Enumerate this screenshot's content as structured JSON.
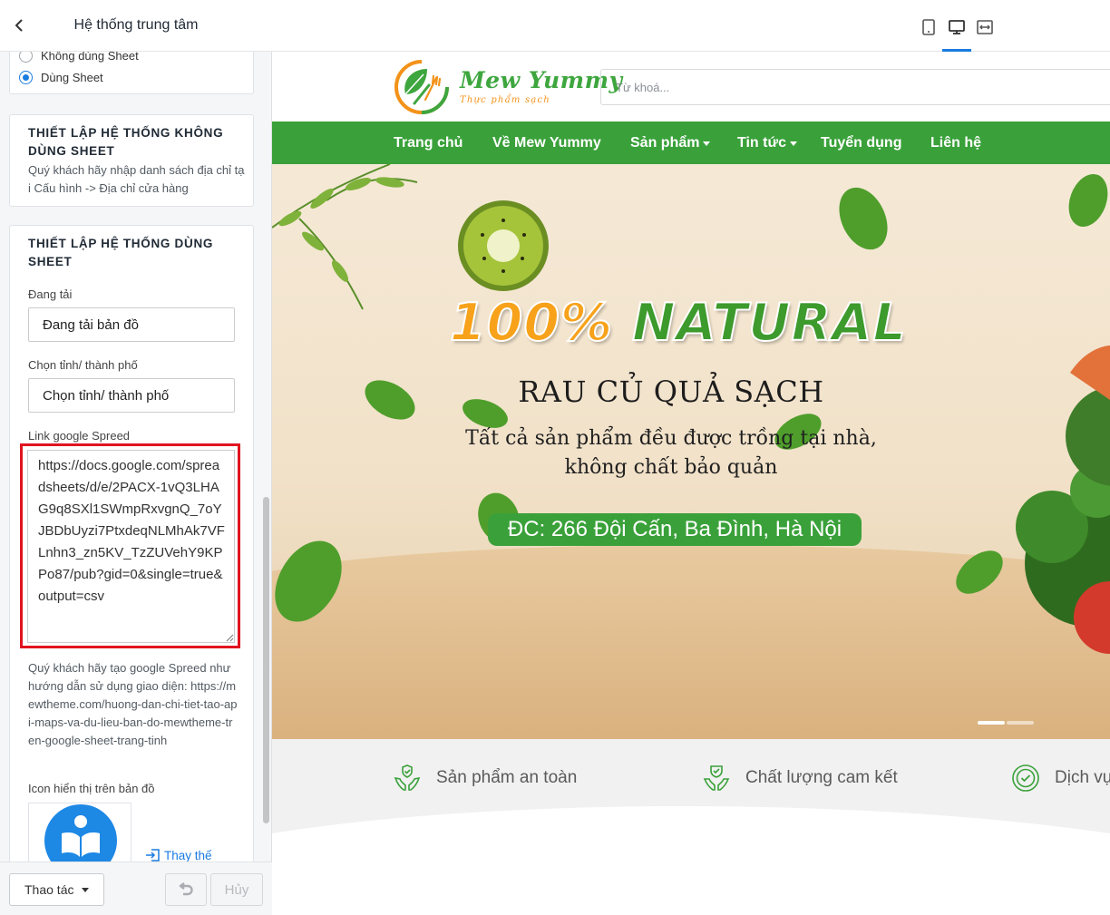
{
  "sidebar": {
    "title": "Hệ thống trung tâm",
    "radio_options": [
      {
        "label": "Không dùng Sheet",
        "checked": false
      },
      {
        "label": "Dùng Sheet",
        "checked": true
      }
    ],
    "no_sheet_section": {
      "heading": "THIẾT LẬP HỆ THỐNG KHÔNG DÙNG SHEET",
      "help": "Quý khách hãy nhập danh sách địa chỉ tại Cấu hình -> Địa chỉ cửa hàng"
    },
    "sheet_section": {
      "heading": "THIẾT LẬP HỆ THỐNG DÙNG SHEET",
      "loading_label": "Đang tải",
      "loading_value": "Đang tải bản đồ",
      "province_label": "Chọn tỉnh/ thành phố",
      "province_value": "Chọn tỉnh/ thành phố",
      "link_label": "Link google Spreed",
      "link_value": "https://docs.google.com/spreadsheets/d/e/2PACX-1vQ3LHAG9q8SXl1SWmpRxvgnQ_7oYJBDbUyzi7PtxdeqNLMhAk7VFLnhn3_zn5KV_TzZUVehY9KPPo87/pub?gid=0&single=true&output=csv",
      "link_help": "Quý khách hãy tạo google Spreed như hướng dẫn sử dụng giao diện: https://mewtheme.com/huong-dan-chi-tiet-tao-api-maps-va-du-lieu-ban-do-mewtheme-tren-google-sheet-trang-tinh",
      "icon_label": "Icon hiển thị trên bản đồ",
      "replace_label": "Thay thế"
    },
    "footer": {
      "actions_label": "Thao tác",
      "cancel_label": "Hủy"
    }
  },
  "preview": {
    "site": {
      "logo_name": "Mew Yummy",
      "logo_tagline": "Thực phẩm sạch",
      "search_placeholder": "Từ khoá...",
      "nav": [
        {
          "label": "Trang chủ",
          "has_dropdown": false
        },
        {
          "label": "Về Mew Yummy",
          "has_dropdown": false
        },
        {
          "label": "Sản phẩm",
          "has_dropdown": true
        },
        {
          "label": "Tin tức",
          "has_dropdown": true
        },
        {
          "label": "Tuyển dụng",
          "has_dropdown": false
        },
        {
          "label": "Liên hệ",
          "has_dropdown": false
        }
      ],
      "banner": {
        "title_part1": "100%",
        "title_part2": "NATURAL",
        "subtitle": "RAU CỦ QUẢ SẠCH",
        "desc_line1": "Tất cả sản phẩm đều được trồng tại nhà,",
        "desc_line2": "không chất bảo quản",
        "address": "ĐC: 266 Đội Cấn, Ba Đình, Hà Nội"
      },
      "features": [
        {
          "label": "Sản phẩm an toàn",
          "icon": "safe-hands-icon"
        },
        {
          "label": "Chất lượng cam kết",
          "icon": "quality-hands-icon"
        },
        {
          "label": "Dịch vụ",
          "icon": "badge-check-icon"
        }
      ]
    }
  },
  "colors": {
    "brand_green": "#3aa13a",
    "accent_orange": "#f7a21a",
    "link_blue": "#1a7be0",
    "highlight_red": "#e0141f"
  }
}
